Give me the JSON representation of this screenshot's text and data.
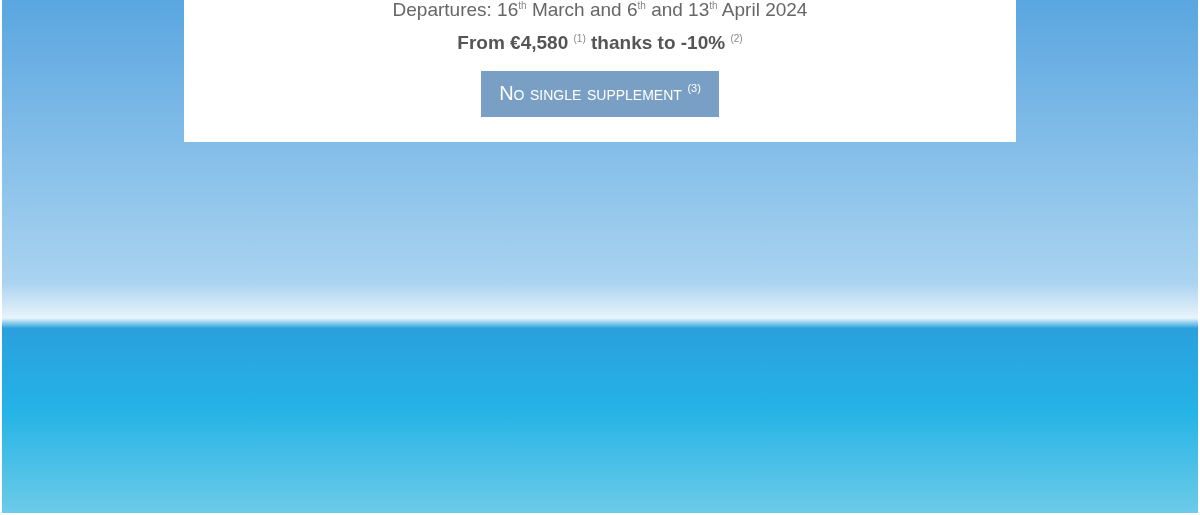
{
  "card": {
    "departures": "Departures: 16$^{th}$ March and 6$^{th}$ and 13$^{th}$ April 2024",
    "price": "**From €4,580** $^{(1)}$ **thanks to -10%** $^{(2)}$",
    "button": "No single supplement $^{(3)}$"
  }
}
